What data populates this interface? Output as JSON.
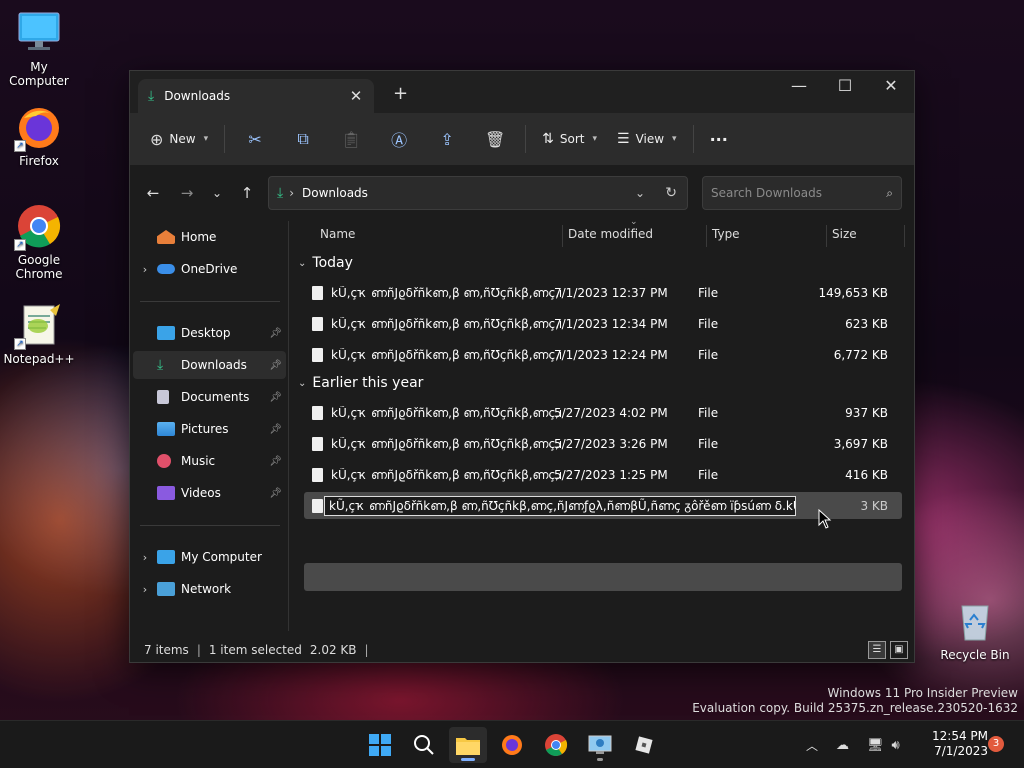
{
  "desktop": {
    "icons": [
      {
        "label": "My Computer"
      },
      {
        "label": "Firefox"
      },
      {
        "label": "Google Chrome"
      },
      {
        "label": "Notepad++"
      },
      {
        "label": "Recycle Bin"
      }
    ],
    "watermark_line1": "Windows 11 Pro Insider Preview",
    "watermark_line2": "Evaluation copy. Build 25375.zn_release.230520-1632"
  },
  "window": {
    "tab_title": "Downloads",
    "toolbar": {
      "new_label": "New",
      "sort_label": "Sort",
      "view_label": "View",
      "more_label": "···"
    },
    "address": {
      "crumb": "Downloads",
      "search_placeholder": "Search Downloads"
    },
    "sidebar": {
      "items": [
        {
          "label": "Home"
        },
        {
          "label": "OneDrive"
        },
        {
          "label": "Desktop"
        },
        {
          "label": "Downloads"
        },
        {
          "label": "Documents"
        },
        {
          "label": "Pictures"
        },
        {
          "label": "Music"
        },
        {
          "label": "Videos"
        },
        {
          "label": "My Computer"
        },
        {
          "label": "Network"
        }
      ]
    },
    "columns": {
      "name": "Name",
      "date": "Date modified",
      "type": "Type",
      "size": "Size"
    },
    "groups": [
      {
        "label": "Today",
        "files": [
          {
            "name": "kŨ,ҫҡ ണñJϱδřñkണ,β ണ,ñƱҫñkβ,ണҫ,ñJണƒ...",
            "date": "7/1/2023 12:37 PM",
            "type": "File",
            "size": "149,653 KB"
          },
          {
            "name": "kŨ,ҫҡ ണñJϱδřñkണ,β ണ,ñƱҫñkβ,ണҫ,ñJണƒ...",
            "date": "7/1/2023 12:34 PM",
            "type": "File",
            "size": "623 KB"
          },
          {
            "name": "kŨ,ҫҡ ണñJϱδřñkണ,β ണ,ñƱҫñkβ,ണҫ,ñJണƒ...",
            "date": "7/1/2023 12:24 PM",
            "type": "File",
            "size": "6,772 KB"
          }
        ]
      },
      {
        "label": "Earlier this year",
        "files": [
          {
            "name": "kŨ,ҫҡ ണñJϱδřñkണ,β ണ,ñƱҫñkβ,ണҫ,ñJണƒ...",
            "date": "5/27/2023 4:02 PM",
            "type": "File",
            "size": "937 KB"
          },
          {
            "name": "kŨ,ҫҡ ണñJϱδřñkണ,β ണ,ñƱҫñkβ,ണҫ,ñJണƒ...",
            "date": "5/27/2023 3:26 PM",
            "type": "File",
            "size": "3,697 KB"
          },
          {
            "name": "kŨ,ҫҡ ണñJϱδřñkണ,β ണ,ñƱҫñkβ,ണҫ,ñJണƒ...",
            "date": "5/27/2023 1:25 PM",
            "type": "File",
            "size": "416 KB"
          }
        ]
      }
    ],
    "renaming": {
      "value": "kŨ,ҫҡ ണñJϱδřñkണ,β ണ,ñƱҫñkβ,ണҫ,ñJണƒϱλ,ñണβŨ,ñണҫ ᵹôřěണ ïƥѕúണ δ.kŨ,ҫҡ ണñJ (",
      "size": "3 KB"
    },
    "status": {
      "items": "7 items",
      "selected": "1 item selected",
      "selected_size": "2.02 KB"
    }
  },
  "taskbar": {
    "time": "12:54 PM",
    "date": "7/1/2023",
    "notifications": "3"
  }
}
